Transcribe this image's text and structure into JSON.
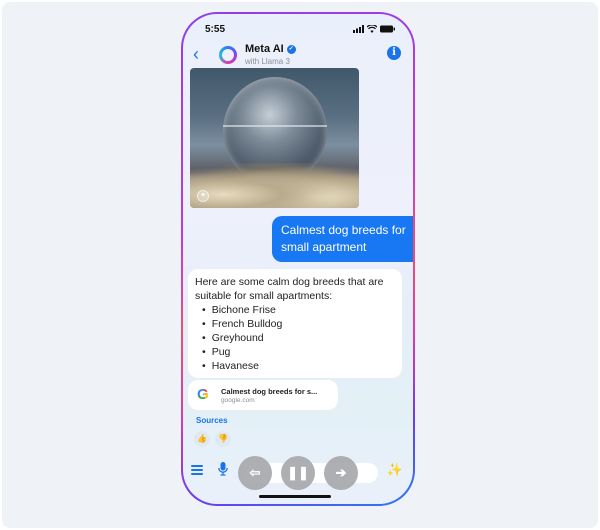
{
  "status_bar": {
    "time": "5:55"
  },
  "header": {
    "back_icon": "chevron-left-icon",
    "title": "Meta AI",
    "verified_icon": "verified-badge-icon",
    "subtitle": "with Llama 3",
    "info_icon": "info-icon",
    "info_glyph": "i"
  },
  "generated_image": {
    "alt": "Glass sphere floating above clouds",
    "overlay_icon": "imagine-sparkle-icon"
  },
  "messages": [
    {
      "role": "user",
      "text": "Calmest dog breeds for small apartment"
    },
    {
      "role": "assistant",
      "intro": "Here are some calm dog breeds that are suitable for small apartments:",
      "items": [
        "Bichone Frise",
        "French Bulldog",
        "Greyhound",
        "Pug",
        "Havanese"
      ]
    }
  ],
  "source_card": {
    "title": "Calmest dog breeds for s...",
    "domain": "google.com",
    "logo_letter": "G"
  },
  "sources_label": "Sources",
  "reactions": {
    "like_glyph": "👍",
    "dislike_glyph": "👎"
  },
  "bottom_bar": {
    "menu_icon": "hamburger-menu-icon",
    "mic_glyph": "🎙",
    "controls": {
      "back_glyph": "⇦",
      "pause_glyph": "❚❚",
      "forward_glyph": "➔"
    },
    "sparkle_glyph": "✨"
  },
  "colors": {
    "accent": "#1877f2",
    "link": "#1a73e8",
    "background": "#eff3f8"
  }
}
